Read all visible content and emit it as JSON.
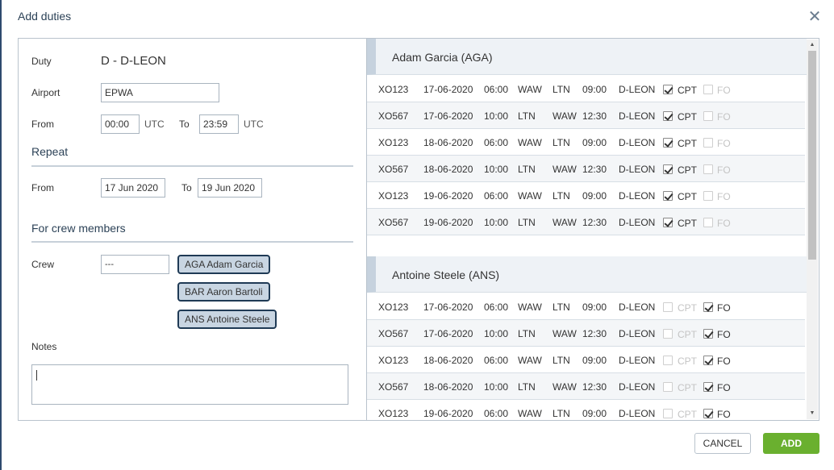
{
  "dialog": {
    "title": "Add duties",
    "close_icon": "close-icon"
  },
  "form": {
    "duty_label": "Duty",
    "duty_value": "D - D-LEON",
    "airport_label": "Airport",
    "airport_value": "EPWA",
    "from_label": "From",
    "from_time": "00:00",
    "utc_label": "UTC",
    "to_label": "To",
    "to_time": "23:59",
    "repeat_heading": "Repeat",
    "repeat_from_label": "From",
    "repeat_from_date": "17 Jun 2020",
    "repeat_to_label": "To",
    "repeat_to_date": "19 Jun 2020",
    "crew_heading": "For crew members",
    "crew_label": "Crew",
    "crew_select_value": "---",
    "crew_members": [
      "AGA Adam Garcia",
      "BAR Aaron Bartoli",
      "ANS Antoine Steele"
    ],
    "notes_label": "Notes",
    "notes_value": ""
  },
  "duties": [
    {
      "name": "Adam Garcia (AGA)",
      "rows": [
        {
          "flight": "XO123",
          "date": "17-06-2020",
          "dep_time": "06:00",
          "from": "WAW",
          "to": "LTN",
          "arr_time": "09:00",
          "reg": "D-LEON",
          "cpt": true,
          "fo": false
        },
        {
          "flight": "XO567",
          "date": "17-06-2020",
          "dep_time": "10:00",
          "from": "LTN",
          "to": "WAW",
          "arr_time": "12:30",
          "reg": "D-LEON",
          "cpt": true,
          "fo": false
        },
        {
          "flight": "XO123",
          "date": "18-06-2020",
          "dep_time": "06:00",
          "from": "WAW",
          "to": "LTN",
          "arr_time": "09:00",
          "reg": "D-LEON",
          "cpt": true,
          "fo": false
        },
        {
          "flight": "XO567",
          "date": "18-06-2020",
          "dep_time": "10:00",
          "from": "LTN",
          "to": "WAW",
          "arr_time": "12:30",
          "reg": "D-LEON",
          "cpt": true,
          "fo": false
        },
        {
          "flight": "XO123",
          "date": "19-06-2020",
          "dep_time": "06:00",
          "from": "WAW",
          "to": "LTN",
          "arr_time": "09:00",
          "reg": "D-LEON",
          "cpt": true,
          "fo": false
        },
        {
          "flight": "XO567",
          "date": "19-06-2020",
          "dep_time": "10:00",
          "from": "LTN",
          "to": "WAW",
          "arr_time": "12:30",
          "reg": "D-LEON",
          "cpt": true,
          "fo": false
        }
      ]
    },
    {
      "name": "Antoine Steele (ANS)",
      "rows": [
        {
          "flight": "XO123",
          "date": "17-06-2020",
          "dep_time": "06:00",
          "from": "WAW",
          "to": "LTN",
          "arr_time": "09:00",
          "reg": "D-LEON",
          "cpt": false,
          "fo": true
        },
        {
          "flight": "XO567",
          "date": "17-06-2020",
          "dep_time": "10:00",
          "from": "LTN",
          "to": "WAW",
          "arr_time": "12:30",
          "reg": "D-LEON",
          "cpt": false,
          "fo": true
        },
        {
          "flight": "XO123",
          "date": "18-06-2020",
          "dep_time": "06:00",
          "from": "WAW",
          "to": "LTN",
          "arr_time": "09:00",
          "reg": "D-LEON",
          "cpt": false,
          "fo": true
        },
        {
          "flight": "XO567",
          "date": "18-06-2020",
          "dep_time": "10:00",
          "from": "LTN",
          "to": "WAW",
          "arr_time": "12:30",
          "reg": "D-LEON",
          "cpt": false,
          "fo": true
        },
        {
          "flight": "XO123",
          "date": "19-06-2020",
          "dep_time": "06:00",
          "from": "WAW",
          "to": "LTN",
          "arr_time": "09:00",
          "reg": "D-LEON",
          "cpt": false,
          "fo": true
        }
      ]
    }
  ],
  "roles": {
    "cpt": "CPT",
    "fo": "FO"
  },
  "buttons": {
    "cancel": "CANCEL",
    "add": "ADD"
  },
  "colors": {
    "accent": "#6ab02f",
    "heading": "#2c4257",
    "pill_bg": "#c8d5e2",
    "pill_border": "#1f3a55"
  }
}
